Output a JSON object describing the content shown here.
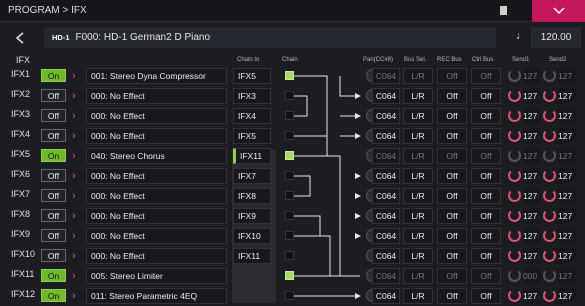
{
  "titlebar": {
    "title": "PROGRAM > IFX",
    "menu_icon": "list-icon",
    "tab_icon": "chevron-down-icon"
  },
  "program": {
    "bank": "HD-1",
    "name": "F000: HD-1 German2 D Piano",
    "tempo_icon": "quarter-note-icon",
    "tempo": "120.00"
  },
  "headers": {
    "ifx": "IFX",
    "chain_to": "Chain to",
    "chain": "Chain",
    "pan": "Pan(CC#8)",
    "bus_sel": "Bus Sel.",
    "rec_bus": "REC Bus",
    "ctrl_bus": "Ctrl Bus",
    "send1": "Send1",
    "send2": "Send2"
  },
  "rows": [
    {
      "label": "IFX1",
      "state": "On",
      "effect": "001: Stereo Dyna Compressor",
      "chain_to": "IFX5",
      "chain_active": false,
      "node_lit": true,
      "pan": "C064",
      "bus": "L/R",
      "rec": "Off",
      "ctrl": "Off",
      "s1": "127",
      "s2": "127",
      "dim": true
    },
    {
      "label": "IFX2",
      "state": "Off",
      "effect": "000: No Effect",
      "chain_to": "IFX3",
      "chain_active": false,
      "node_lit": false,
      "pan": "C064",
      "bus": "L/R",
      "rec": "Off",
      "ctrl": "Off",
      "s1": "127",
      "s2": "127",
      "dim": false
    },
    {
      "label": "IFX3",
      "state": "Off",
      "effect": "000: No Effect",
      "chain_to": "IFX4",
      "chain_active": false,
      "node_lit": false,
      "pan": "C064",
      "bus": "L/R",
      "rec": "Off",
      "ctrl": "Off",
      "s1": "127",
      "s2": "127",
      "dim": false
    },
    {
      "label": "IFX4",
      "state": "Off",
      "effect": "000: No Effect",
      "chain_to": "IFX5",
      "chain_active": false,
      "node_lit": false,
      "pan": "C064",
      "bus": "L/R",
      "rec": "Off",
      "ctrl": "Off",
      "s1": "127",
      "s2": "127",
      "dim": false
    },
    {
      "label": "IFX5",
      "state": "On",
      "effect": "040: Stereo Chorus",
      "chain_to": "IFX11",
      "chain_active": true,
      "node_lit": true,
      "pan": "C064",
      "bus": "L/R",
      "rec": "Off",
      "ctrl": "Off",
      "s1": "127",
      "s2": "127",
      "dim": true
    },
    {
      "label": "IFX6",
      "state": "Off",
      "effect": "000: No Effect",
      "chain_to": "IFX7",
      "chain_active": false,
      "node_lit": false,
      "pan": "C064",
      "bus": "L/R",
      "rec": "Off",
      "ctrl": "Off",
      "s1": "127",
      "s2": "127",
      "dim": false
    },
    {
      "label": "IFX7",
      "state": "Off",
      "effect": "000: No Effect",
      "chain_to": "IFX8",
      "chain_active": false,
      "node_lit": false,
      "pan": "C064",
      "bus": "L/R",
      "rec": "Off",
      "ctrl": "Off",
      "s1": "127",
      "s2": "127",
      "dim": false
    },
    {
      "label": "IFX8",
      "state": "Off",
      "effect": "000: No Effect",
      "chain_to": "IFX9",
      "chain_active": false,
      "node_lit": false,
      "pan": "C064",
      "bus": "L/R",
      "rec": "Off",
      "ctrl": "Off",
      "s1": "127",
      "s2": "127",
      "dim": false
    },
    {
      "label": "IFX9",
      "state": "Off",
      "effect": "000: No Effect",
      "chain_to": "IFX10",
      "chain_active": false,
      "node_lit": false,
      "pan": "C064",
      "bus": "L/R",
      "rec": "Off",
      "ctrl": "Off",
      "s1": "127",
      "s2": "127",
      "dim": false
    },
    {
      "label": "IFX10",
      "state": "Off",
      "effect": "000: No Effect",
      "chain_to": "IFX11",
      "chain_active": false,
      "node_lit": false,
      "pan": "C064",
      "bus": "L/R",
      "rec": "Off",
      "ctrl": "Off",
      "s1": "127",
      "s2": "127",
      "dim": false
    },
    {
      "label": "IFX11",
      "state": "On",
      "effect": "005: Stereo Limiter",
      "chain_to": "",
      "chain_active": false,
      "node_lit": true,
      "pan": "C064",
      "bus": "L/R",
      "rec": "Off",
      "ctrl": "Off",
      "s1": "000",
      "s2": "127",
      "dim": true
    },
    {
      "label": "IFX12",
      "state": "On",
      "effect": "011: Stereo Parametric 4EQ",
      "chain_to": "",
      "chain_active": false,
      "node_lit": false,
      "pan": "C064",
      "bus": "L/R",
      "rec": "Off",
      "ctrl": "Off",
      "s1": "127",
      "s2": "127",
      "dim": false
    }
  ],
  "colors": {
    "on_green": "#71b82e",
    "accent_pink": "#c2185b",
    "send_red": "#e0526e"
  }
}
